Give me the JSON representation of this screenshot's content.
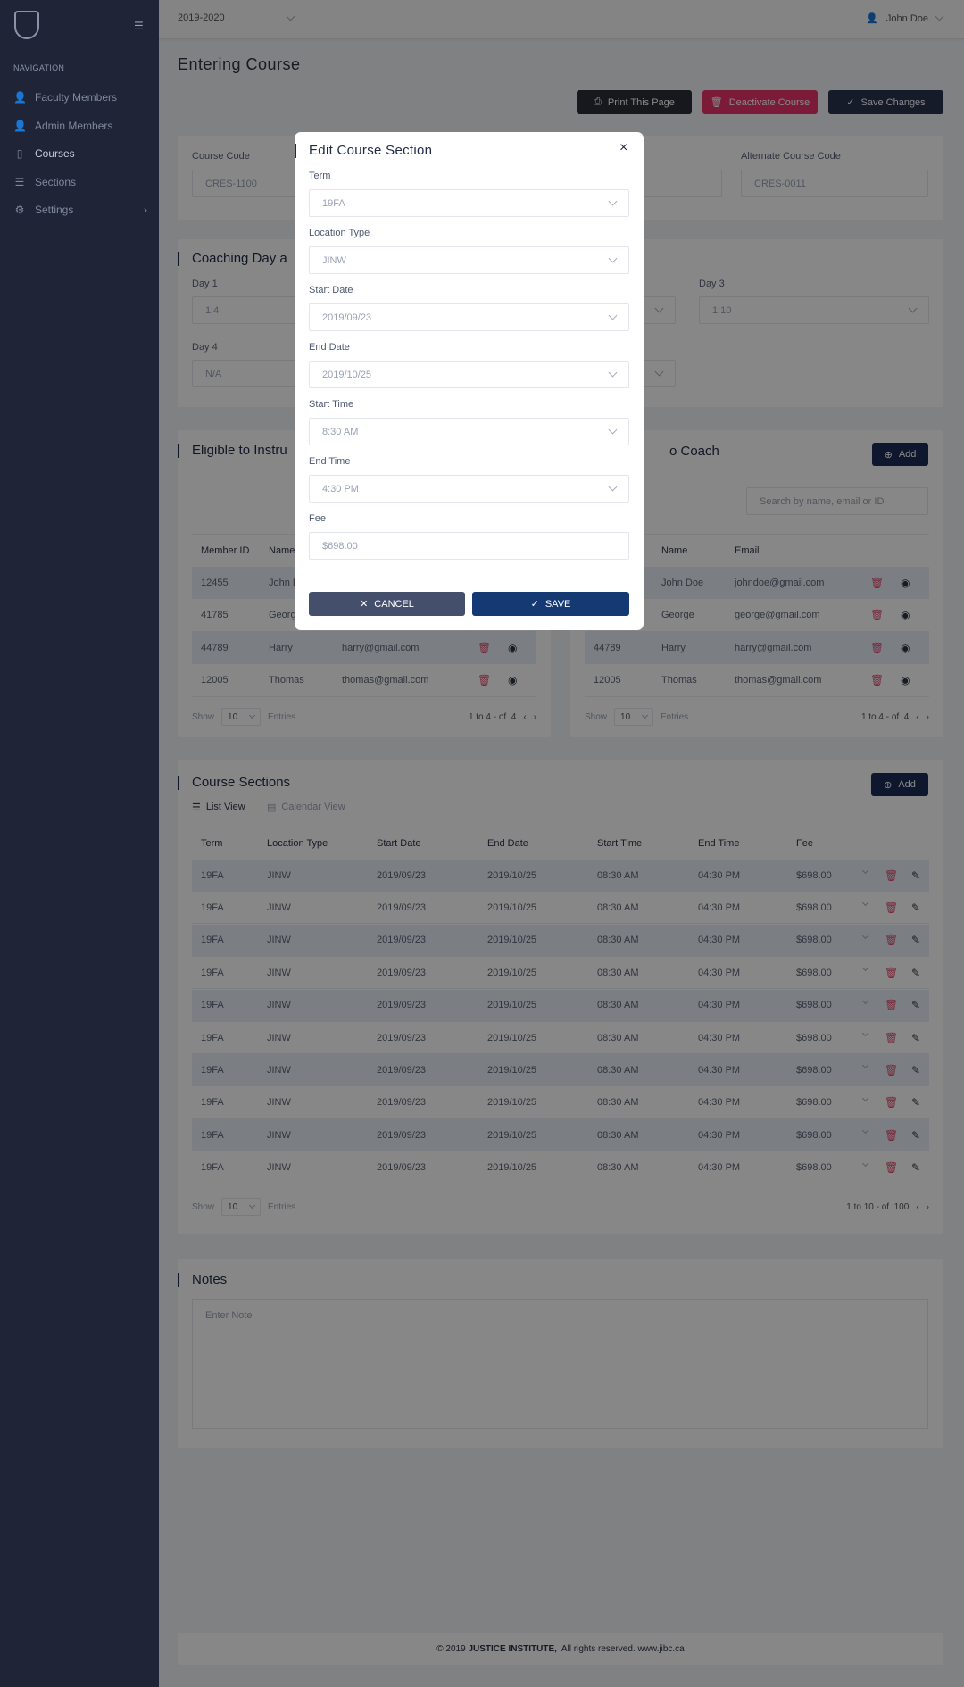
{
  "sidebar": {
    "nav_heading": "NAVIGATION",
    "items": [
      {
        "label": "Faculty Members",
        "icon": "user-icon"
      },
      {
        "label": "Admin Members",
        "icon": "user-icon"
      },
      {
        "label": "Courses",
        "icon": "book-icon",
        "active": true
      },
      {
        "label": "Sections",
        "icon": "sections-icon"
      },
      {
        "label": "Settings",
        "icon": "gear-icon"
      }
    ]
  },
  "topbar": {
    "year": "2019-2020",
    "user": "John Doe"
  },
  "page": {
    "title": "Entering Course",
    "buttons": {
      "print": "Print This Page",
      "deactivate": "Deactivate Course",
      "save": "Save Changes"
    }
  },
  "course_codes": {
    "course_code_label": "Course Code",
    "course_code": "CRES-1100",
    "alt_label": "Alternate Course Code",
    "alt_code": "CRES-0011"
  },
  "coaching": {
    "title": "Coaching Day a",
    "day1_label": "Day 1",
    "day1": "1:4",
    "day3_label": "Day 3",
    "day3": "1:10",
    "day4_label": "Day 4",
    "day4": "N/A"
  },
  "eligible": {
    "left_title": "Eligible to Instru",
    "right_title": "o Coach",
    "add": "Add",
    "search_placeholder": "Search by name, email or ID",
    "columns": [
      "Member ID",
      "Name",
      "Email"
    ],
    "rows": [
      [
        "12455",
        "John Doe",
        "johndoe@gmail.com"
      ],
      [
        "41785",
        "George",
        "george@gmail.com"
      ],
      [
        "44789",
        "Harry",
        "harry@gmail.com"
      ],
      [
        "12005",
        "Thomas",
        "thomas@gmail.com"
      ]
    ],
    "show": "Show",
    "entries": "Entries",
    "page_size": "10",
    "pagination": "1 to 4 - of  4"
  },
  "sections": {
    "title": "Course Sections",
    "add": "Add",
    "list_view": "List View",
    "calendar_view": "Calendar View",
    "columns": [
      "Term",
      "Location Type",
      "Start Date",
      "End Date",
      "Start Time",
      "End Time",
      "Fee"
    ],
    "rows": [
      [
        "19FA",
        "JINW",
        "2019/09/23",
        "2019/10/25",
        "08:30 AM",
        "04:30 PM",
        "$698.00"
      ],
      [
        "19FA",
        "JINW",
        "2019/09/23",
        "2019/10/25",
        "08:30 AM",
        "04:30 PM",
        "$698.00"
      ],
      [
        "19FA",
        "JINW",
        "2019/09/23",
        "2019/10/25",
        "08:30 AM",
        "04:30 PM",
        "$698.00"
      ],
      [
        "19FA",
        "JINW",
        "2019/09/23",
        "2019/10/25",
        "08:30 AM",
        "04:30 PM",
        "$698.00"
      ],
      [
        "19FA",
        "JINW",
        "2019/09/23",
        "2019/10/25",
        "08:30 AM",
        "04:30 PM",
        "$698.00"
      ],
      [
        "19FA",
        "JINW",
        "2019/09/23",
        "2019/10/25",
        "08:30 AM",
        "04:30 PM",
        "$698.00"
      ],
      [
        "19FA",
        "JINW",
        "2019/09/23",
        "2019/10/25",
        "08:30 AM",
        "04:30 PM",
        "$698.00"
      ],
      [
        "19FA",
        "JINW",
        "2019/09/23",
        "2019/10/25",
        "08:30 AM",
        "04:30 PM",
        "$698.00"
      ],
      [
        "19FA",
        "JINW",
        "2019/09/23",
        "2019/10/25",
        "08:30 AM",
        "04:30 PM",
        "$698.00"
      ],
      [
        "19FA",
        "JINW",
        "2019/09/23",
        "2019/10/25",
        "08:30 AM",
        "04:30 PM",
        "$698.00"
      ]
    ],
    "show": "Show",
    "entries": "Entries",
    "page_size": "10",
    "pagination": "1 to 10 - of  100"
  },
  "notes": {
    "title": "Notes",
    "placeholder": "Enter Note"
  },
  "footer": {
    "prefix": "© 2019 ",
    "brand": "JUSTICE INSTITUTE,",
    "suffix": "  All rights reserved. www.jibc.ca"
  },
  "modal": {
    "title": "Edit Course Section",
    "fields": [
      {
        "label": "Term",
        "value": "19FA",
        "type": "select"
      },
      {
        "label": "Location Type",
        "value": "JINW",
        "type": "select"
      },
      {
        "label": "Start Date",
        "value": "2019/09/23",
        "type": "select"
      },
      {
        "label": "End Date",
        "value": "2019/10/25",
        "type": "select"
      },
      {
        "label": "Start Time",
        "value": "8:30 AM",
        "type": "select"
      },
      {
        "label": "End Time",
        "value": "4:30 PM",
        "type": "select"
      },
      {
        "label": "Fee",
        "value": "$698.00",
        "type": "text"
      }
    ],
    "cancel": "CANCEL",
    "save": "SAVE"
  },
  "colors": {
    "sidebar": "#1f2537",
    "deactivate": "#e8336a",
    "save_changes": "#2a3350",
    "modal_save": "#153a73",
    "modal_cancel": "#44506b"
  }
}
